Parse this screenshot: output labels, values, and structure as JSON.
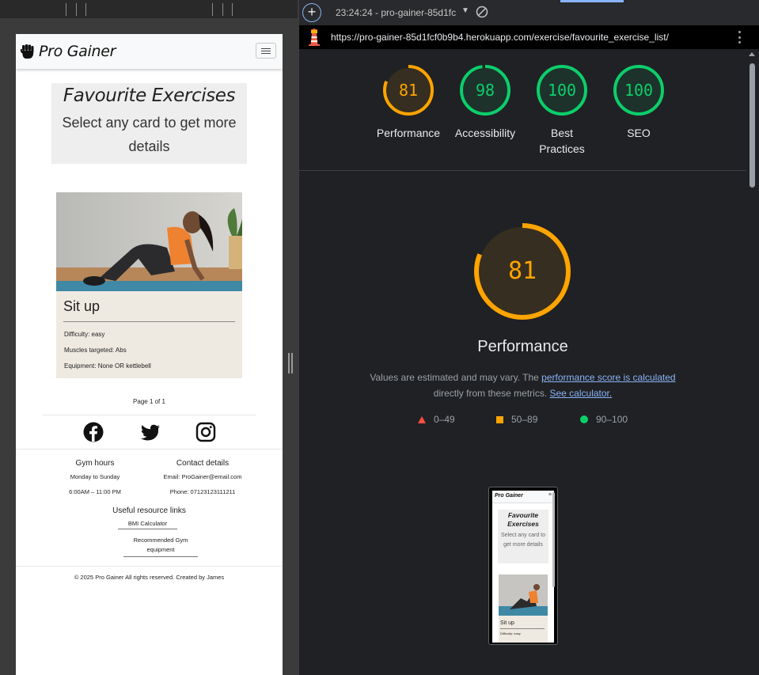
{
  "site": {
    "brand": "Pro Gainer",
    "hero_title": "Favourite Exercises",
    "hero_subtitle": "Select any card to get more details",
    "card": {
      "title": "Sit up",
      "difficulty": "Difficulty: easy",
      "muscles": "Muscles targeted: Abs",
      "equipment": "Equipment: None OR kettlebell"
    },
    "pagination": "Page 1 of 1",
    "social": [
      "facebook-icon",
      "twitter-icon",
      "instagram-icon"
    ],
    "footer": {
      "gym_hours_heading": "Gym hours",
      "gym_days": "Monday to Sunday",
      "gym_times": "6:00AM – 11:00 PM",
      "contact_heading": "Contact details",
      "email": "Email: ProGainer@email.com",
      "phone": "Phone: 07123123111211",
      "links_heading": "Useful resource links",
      "link_bmi": "BMI Calculator",
      "link_equipment": "Recommended Gym equipment",
      "copyright": "© 2025 Pro Gainer All rights reserved. Created by James"
    }
  },
  "lighthouse": {
    "report_select": "23:24:24 - pro-gainer-85d1fc",
    "url": "https://pro-gainer-85d1fcf0b9b4.herokuapp.com/exercise/favourite_exercise_list/",
    "gauges": [
      {
        "value": "81",
        "label": "Performance",
        "score": 0.81,
        "color": "#ffa400"
      },
      {
        "value": "98",
        "label": "Accessibility",
        "score": 0.98,
        "color": "#0cce6b"
      },
      {
        "value": "100",
        "label": "Best Practices",
        "score": 1.0,
        "color": "#0cce6b"
      },
      {
        "value": "100",
        "label": "SEO",
        "score": 1.0,
        "color": "#0cce6b"
      }
    ],
    "main_score": {
      "value": "81",
      "label": "Performance",
      "score": 0.81,
      "color": "#ffa400"
    },
    "desc_part1": "Values are estimated and may vary. The ",
    "desc_link1": "performance score is calculated",
    "desc_part2": "directly from these metrics.",
    "desc_link2": "See calculator.",
    "legend": [
      "0–49",
      "50–89",
      "90–100"
    ],
    "thumbnail": {
      "brand": "Pro Gainer",
      "title": "Favourite Exercises",
      "subtitle": "Select any card to get more details",
      "card_title": "Sit up",
      "card_line": "Difficulty: easy"
    }
  }
}
